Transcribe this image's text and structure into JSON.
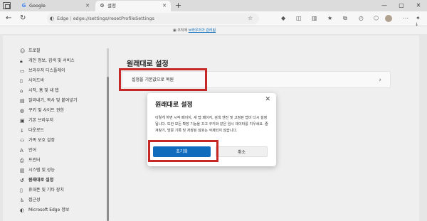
{
  "tabs": [
    {
      "label": "Google",
      "icon": "google-icon"
    },
    {
      "label": "설정",
      "icon": "gear-icon"
    }
  ],
  "address": {
    "site_label": "Edge",
    "url": "edge://settings/resetProfileSettings"
  },
  "managed_bar": {
    "prefix": "조직에",
    "link": "브라우저가 관리됨"
  },
  "sidebar": {
    "items": [
      {
        "label": "프로필",
        "icon": "profile-icon"
      },
      {
        "label": "개인 정보, 검색 및 서비스",
        "icon": "lock-icon"
      },
      {
        "label": "브라우저 디스플레이",
        "icon": "display-icon"
      },
      {
        "label": "사이드바",
        "icon": "sidebar-icon"
      },
      {
        "label": "시작, 홈 및 새 탭",
        "icon": "home-icon"
      },
      {
        "label": "잘라내기, 복사 및 붙여넣기",
        "icon": "clipboard-icon"
      },
      {
        "label": "쿠키 및 사이트 권한",
        "icon": "cookie-icon"
      },
      {
        "label": "기본 브라우저",
        "icon": "browser-icon"
      },
      {
        "label": "다운로드",
        "icon": "download-icon"
      },
      {
        "label": "가족 보호 설정",
        "icon": "family-icon"
      },
      {
        "label": "언어",
        "icon": "language-icon"
      },
      {
        "label": "프린터",
        "icon": "printer-icon"
      },
      {
        "label": "시스템 및 성능",
        "icon": "system-icon"
      },
      {
        "label": "원래대로 설정",
        "icon": "reset-icon"
      },
      {
        "label": "휴대폰 및 기타 장치",
        "icon": "phone-icon"
      },
      {
        "label": "접근성",
        "icon": "accessibility-icon"
      },
      {
        "label": "Microsoft Edge 정보",
        "icon": "edge-icon"
      }
    ]
  },
  "main": {
    "title": "원래대로 설정",
    "reset_row_label": "설정을 기본값으로 복원"
  },
  "dialog": {
    "title": "원래대로 설정",
    "body": "이렇게 하면 시작 페이지, 새 탭 페이지, 검색 엔진 및 고정된 탭이 다시 설정됩니다. 또한 모든 확장 기능을 끄고 쿠키와 같은 임시 데이터를 지우세요. 즐겨찾기, 방문 기록 및 저장된 암호는 삭제되지 않습니다.",
    "confirm_label": "초기화",
    "cancel_label": "취소"
  },
  "colors": {
    "accent": "#0f6cbd",
    "highlight": "#c62828"
  }
}
